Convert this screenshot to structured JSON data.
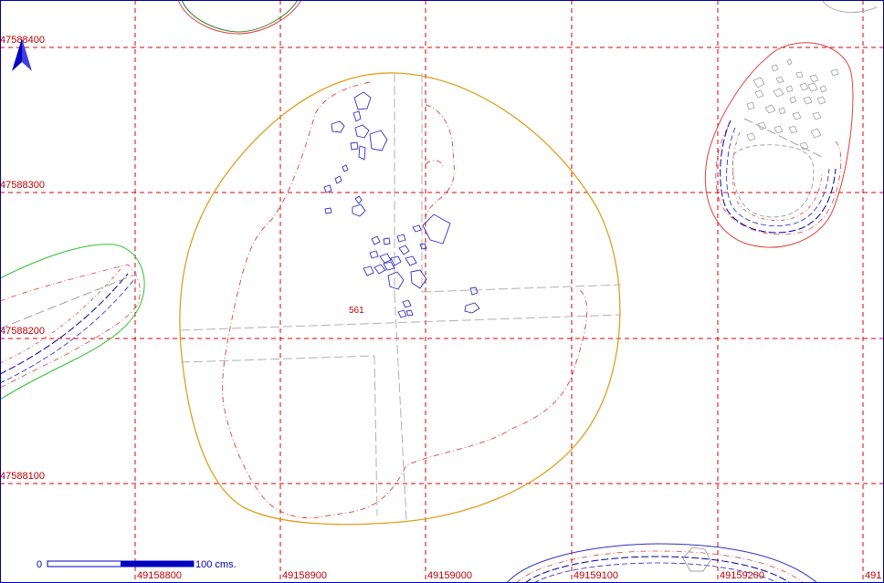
{
  "map": {
    "grid_color": "#e00000",
    "grid_x_labels": [
      "49158800",
      "49158900",
      "49159000",
      "49159100",
      "49159200",
      "491"
    ],
    "grid_y_labels": [
      "47588400",
      "47588300",
      "47588200",
      "47588100"
    ],
    "feature_label": "561",
    "scale_bar": {
      "start": "0",
      "end_label": "100 cms."
    },
    "colors": {
      "outline_orange": "#e0a020",
      "outline_red": "#e04040",
      "stones_blue": "#3030c0",
      "outline_green": "#30c030",
      "section_gray": "#b0b0b0",
      "north_arrow": "#0000c0"
    },
    "icons": {
      "north": "north-arrow-icon"
    }
  }
}
